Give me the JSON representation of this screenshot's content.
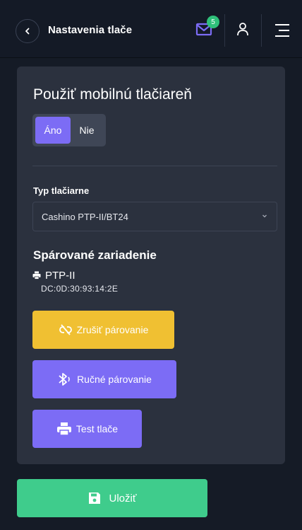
{
  "header": {
    "title": "Nastavenia tlače",
    "mail_badge": "5"
  },
  "colors": {
    "accent": "#7c6cf5",
    "warning": "#f0c032",
    "success": "#3fcc8c",
    "badge": "#2fc07a"
  },
  "printer_section": {
    "title": "Použiť mobilnú tlačiareň",
    "toggle": {
      "yes": "Áno",
      "no": "Nie",
      "selected": "Áno"
    },
    "printer_type_label": "Typ tlačiarne",
    "printer_type_value": "Cashino PTP-II/BT24",
    "paired_title": "Spárované zariadenie",
    "device_name": "PTP-II",
    "device_mac": "DC:0D:30:93:14:2E",
    "buttons": {
      "unpair": "Zrušiť párovanie",
      "manual_pair": "Ručné párovanie",
      "test_print": "Test tlače"
    }
  },
  "save_button": "Uložiť",
  "icons": [
    "chevron-left-icon",
    "mail-icon",
    "user-icon",
    "menu-icon",
    "chevron-down-icon",
    "printer-icon",
    "unlink-icon",
    "bluetooth-icon",
    "save-icon"
  ]
}
